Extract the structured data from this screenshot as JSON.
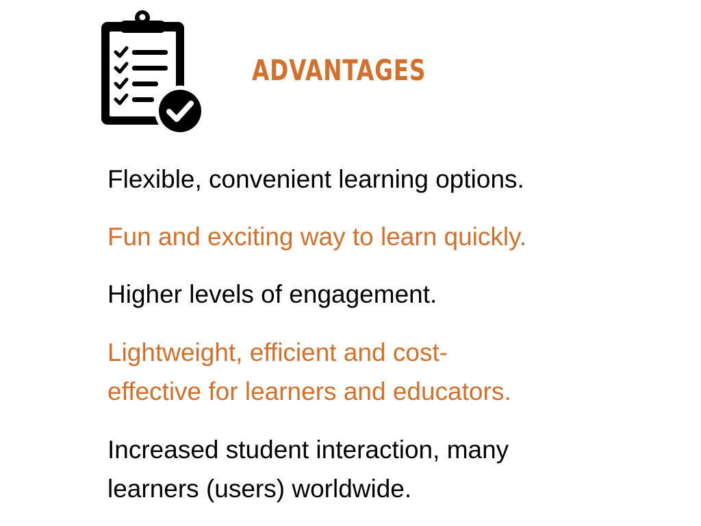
{
  "slide": {
    "title": "ADVANTAGES",
    "icon": "clipboard-checklist-icon",
    "colors": {
      "accent": "#D2702C",
      "text": "#000000",
      "background": "#FFFFFF"
    },
    "bullets": [
      {
        "color": "#000000",
        "lines": [
          "Flexible, convenient learning options."
        ]
      },
      {
        "color": "#D2702C",
        "lines": [
          "Fun and exciting way to learn quickly."
        ]
      },
      {
        "color": "#000000",
        "lines": [
          "Higher levels of engagement."
        ]
      },
      {
        "color": "#D2702C",
        "lines": [
          "Lightweight, efficient and cost-",
          "effective for learners and educators."
        ]
      },
      {
        "color": "#000000",
        "lines": [
          "Increased student interaction, many",
          "learners (users) worldwide."
        ]
      }
    ]
  }
}
